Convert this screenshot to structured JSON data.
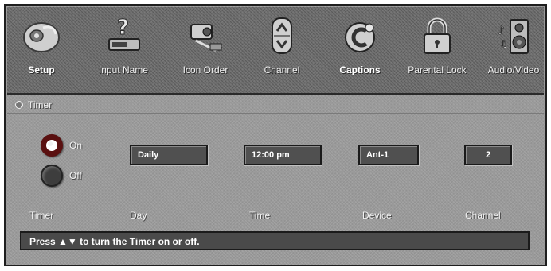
{
  "menu": {
    "items": [
      {
        "label": "Setup",
        "icon": "setup-icon",
        "active": true
      },
      {
        "label": "Input Name",
        "icon": "input-name-icon"
      },
      {
        "label": "Icon Order",
        "icon": "icon-order-icon"
      },
      {
        "label": "Channel",
        "icon": "channel-icon"
      },
      {
        "label": "Captions",
        "icon": "captions-icon"
      },
      {
        "label": "Parental Lock",
        "icon": "parental-lock-icon"
      },
      {
        "label": "Audio/Video",
        "icon": "audio-video-icon"
      }
    ]
  },
  "section": {
    "title": "Timer"
  },
  "timer": {
    "on_label": "On",
    "off_label": "Off",
    "selected": "On"
  },
  "fields": {
    "day": "Daily",
    "time": "12:00 pm",
    "device": "Ant-1",
    "channel": "2"
  },
  "labels": {
    "timer": "Timer",
    "day": "Day",
    "time": "Time",
    "device": "Device",
    "channel": "Channel"
  },
  "status": {
    "message": "Press ▲▼ to turn the Timer on or off."
  }
}
